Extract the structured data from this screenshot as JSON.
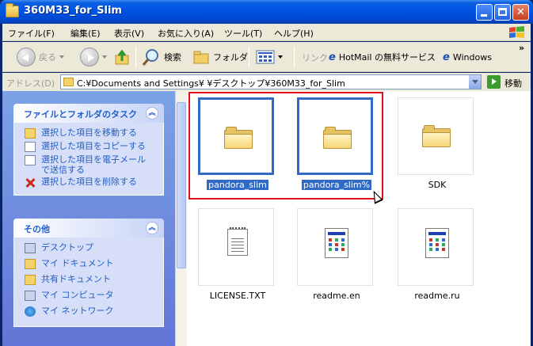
{
  "window": {
    "title": "360M33_for_Slim"
  },
  "menu": [
    "ファイル(F)",
    "編集(E)",
    "表示(V)",
    "お気に入り(A)",
    "ツール(T)",
    "ヘルプ(H)"
  ],
  "toolbar": {
    "back_label": "戻る",
    "search_label": "検索",
    "folders_label": "フォルダ",
    "links_label": "リンク",
    "link1": "HotMail の無料サービス",
    "link2": "Windows",
    "more": "»"
  },
  "address": {
    "label": "アドレス(D)",
    "path": "C:¥Documents and Settings¥      ¥デスクトップ¥360M33_for_Slim",
    "go_label": "移動"
  },
  "tasks_panel": {
    "title": "ファイルとフォルダのタスク",
    "items": [
      "選択した項目を移動する",
      "選択した項目をコピーする",
      "選択した項目を電子メールで送信する",
      "選択した項目を削除する"
    ]
  },
  "other_panel": {
    "title": "その他",
    "items": [
      "デスクトップ",
      "マイ ドキュメント",
      "共有ドキュメント",
      "マイ コンピュータ",
      "マイ ネットワーク"
    ]
  },
  "files": [
    {
      "name": "pandora_slim",
      "type": "folder",
      "selected": true
    },
    {
      "name": "pandora_slim%",
      "type": "folder",
      "selected": true
    },
    {
      "name": "SDK",
      "type": "folder",
      "selected": false
    },
    {
      "name": "LICENSE.TXT",
      "type": "text",
      "selected": false
    },
    {
      "name": "readme.en",
      "type": "web",
      "selected": false
    },
    {
      "name": "readme.ru",
      "type": "web",
      "selected": false
    }
  ],
  "colors": {
    "title_bar": "#0054e3",
    "selection": "#316ac5",
    "highlight_box": "#e0101d",
    "task_link": "#215dc6"
  }
}
